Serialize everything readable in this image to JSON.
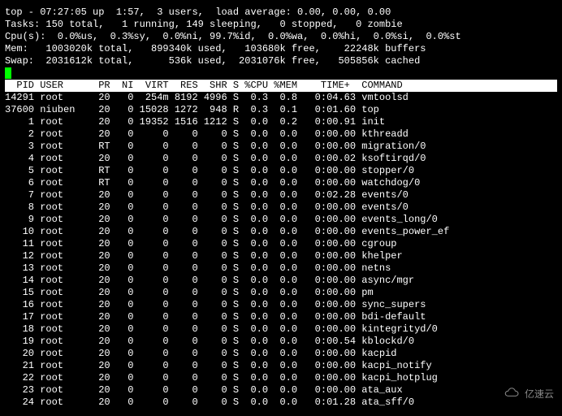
{
  "summary": {
    "line1": "top - 07:27:05 up  1:57,  3 users,  load average: 0.00, 0.00, 0.00",
    "line2": "Tasks: 150 total,   1 running, 149 sleeping,   0 stopped,   0 zombie",
    "line3": "Cpu(s):  0.0%us,  0.3%sy,  0.0%ni, 99.7%id,  0.0%wa,  0.0%hi,  0.0%si,  0.0%st",
    "line4": "Mem:   1003020k total,   899340k used,   103680k free,    22248k buffers",
    "line5": "Swap:  2031612k total,      536k used,  2031076k free,   505856k cached"
  },
  "columns": [
    "PID",
    "USER",
    "PR",
    "NI",
    "VIRT",
    "RES",
    "SHR",
    "S",
    "%CPU",
    "%MEM",
    "TIME+",
    "COMMAND"
  ],
  "header_text": "  PID USER      PR  NI  VIRT  RES  SHR S %CPU %MEM    TIME+  COMMAND           ",
  "processes": [
    {
      "pid": "14291",
      "user": "root",
      "pr": "20",
      "ni": "0",
      "virt": "254m",
      "res": "8192",
      "shr": "4996",
      "s": "S",
      "cpu": "0.3",
      "mem": "0.8",
      "time": "0:04.63",
      "cmd": "vmtoolsd"
    },
    {
      "pid": "37600",
      "user": "niuben",
      "pr": "20",
      "ni": "0",
      "virt": "15028",
      "res": "1272",
      "shr": "948",
      "s": "R",
      "cpu": "0.3",
      "mem": "0.1",
      "time": "0:01.60",
      "cmd": "top"
    },
    {
      "pid": "1",
      "user": "root",
      "pr": "20",
      "ni": "0",
      "virt": "19352",
      "res": "1516",
      "shr": "1212",
      "s": "S",
      "cpu": "0.0",
      "mem": "0.2",
      "time": "0:00.91",
      "cmd": "init"
    },
    {
      "pid": "2",
      "user": "root",
      "pr": "20",
      "ni": "0",
      "virt": "0",
      "res": "0",
      "shr": "0",
      "s": "S",
      "cpu": "0.0",
      "mem": "0.0",
      "time": "0:00.00",
      "cmd": "kthreadd"
    },
    {
      "pid": "3",
      "user": "root",
      "pr": "RT",
      "ni": "0",
      "virt": "0",
      "res": "0",
      "shr": "0",
      "s": "S",
      "cpu": "0.0",
      "mem": "0.0",
      "time": "0:00.00",
      "cmd": "migration/0"
    },
    {
      "pid": "4",
      "user": "root",
      "pr": "20",
      "ni": "0",
      "virt": "0",
      "res": "0",
      "shr": "0",
      "s": "S",
      "cpu": "0.0",
      "mem": "0.0",
      "time": "0:00.02",
      "cmd": "ksoftirqd/0"
    },
    {
      "pid": "5",
      "user": "root",
      "pr": "RT",
      "ni": "0",
      "virt": "0",
      "res": "0",
      "shr": "0",
      "s": "S",
      "cpu": "0.0",
      "mem": "0.0",
      "time": "0:00.00",
      "cmd": "stopper/0"
    },
    {
      "pid": "6",
      "user": "root",
      "pr": "RT",
      "ni": "0",
      "virt": "0",
      "res": "0",
      "shr": "0",
      "s": "S",
      "cpu": "0.0",
      "mem": "0.0",
      "time": "0:00.00",
      "cmd": "watchdog/0"
    },
    {
      "pid": "7",
      "user": "root",
      "pr": "20",
      "ni": "0",
      "virt": "0",
      "res": "0",
      "shr": "0",
      "s": "S",
      "cpu": "0.0",
      "mem": "0.0",
      "time": "0:02.28",
      "cmd": "events/0"
    },
    {
      "pid": "8",
      "user": "root",
      "pr": "20",
      "ni": "0",
      "virt": "0",
      "res": "0",
      "shr": "0",
      "s": "S",
      "cpu": "0.0",
      "mem": "0.0",
      "time": "0:00.00",
      "cmd": "events/0"
    },
    {
      "pid": "9",
      "user": "root",
      "pr": "20",
      "ni": "0",
      "virt": "0",
      "res": "0",
      "shr": "0",
      "s": "S",
      "cpu": "0.0",
      "mem": "0.0",
      "time": "0:00.00",
      "cmd": "events_long/0"
    },
    {
      "pid": "10",
      "user": "root",
      "pr": "20",
      "ni": "0",
      "virt": "0",
      "res": "0",
      "shr": "0",
      "s": "S",
      "cpu": "0.0",
      "mem": "0.0",
      "time": "0:00.00",
      "cmd": "events_power_ef"
    },
    {
      "pid": "11",
      "user": "root",
      "pr": "20",
      "ni": "0",
      "virt": "0",
      "res": "0",
      "shr": "0",
      "s": "S",
      "cpu": "0.0",
      "mem": "0.0",
      "time": "0:00.00",
      "cmd": "cgroup"
    },
    {
      "pid": "12",
      "user": "root",
      "pr": "20",
      "ni": "0",
      "virt": "0",
      "res": "0",
      "shr": "0",
      "s": "S",
      "cpu": "0.0",
      "mem": "0.0",
      "time": "0:00.00",
      "cmd": "khelper"
    },
    {
      "pid": "13",
      "user": "root",
      "pr": "20",
      "ni": "0",
      "virt": "0",
      "res": "0",
      "shr": "0",
      "s": "S",
      "cpu": "0.0",
      "mem": "0.0",
      "time": "0:00.00",
      "cmd": "netns"
    },
    {
      "pid": "14",
      "user": "root",
      "pr": "20",
      "ni": "0",
      "virt": "0",
      "res": "0",
      "shr": "0",
      "s": "S",
      "cpu": "0.0",
      "mem": "0.0",
      "time": "0:00.00",
      "cmd": "async/mgr"
    },
    {
      "pid": "15",
      "user": "root",
      "pr": "20",
      "ni": "0",
      "virt": "0",
      "res": "0",
      "shr": "0",
      "s": "S",
      "cpu": "0.0",
      "mem": "0.0",
      "time": "0:00.00",
      "cmd": "pm"
    },
    {
      "pid": "16",
      "user": "root",
      "pr": "20",
      "ni": "0",
      "virt": "0",
      "res": "0",
      "shr": "0",
      "s": "S",
      "cpu": "0.0",
      "mem": "0.0",
      "time": "0:00.00",
      "cmd": "sync_supers"
    },
    {
      "pid": "17",
      "user": "root",
      "pr": "20",
      "ni": "0",
      "virt": "0",
      "res": "0",
      "shr": "0",
      "s": "S",
      "cpu": "0.0",
      "mem": "0.0",
      "time": "0:00.00",
      "cmd": "bdi-default"
    },
    {
      "pid": "18",
      "user": "root",
      "pr": "20",
      "ni": "0",
      "virt": "0",
      "res": "0",
      "shr": "0",
      "s": "S",
      "cpu": "0.0",
      "mem": "0.0",
      "time": "0:00.00",
      "cmd": "kintegrityd/0"
    },
    {
      "pid": "19",
      "user": "root",
      "pr": "20",
      "ni": "0",
      "virt": "0",
      "res": "0",
      "shr": "0",
      "s": "S",
      "cpu": "0.0",
      "mem": "0.0",
      "time": "0:00.54",
      "cmd": "kblockd/0"
    },
    {
      "pid": "20",
      "user": "root",
      "pr": "20",
      "ni": "0",
      "virt": "0",
      "res": "0",
      "shr": "0",
      "s": "S",
      "cpu": "0.0",
      "mem": "0.0",
      "time": "0:00.00",
      "cmd": "kacpid"
    },
    {
      "pid": "21",
      "user": "root",
      "pr": "20",
      "ni": "0",
      "virt": "0",
      "res": "0",
      "shr": "0",
      "s": "S",
      "cpu": "0.0",
      "mem": "0.0",
      "time": "0:00.00",
      "cmd": "kacpi_notify"
    },
    {
      "pid": "22",
      "user": "root",
      "pr": "20",
      "ni": "0",
      "virt": "0",
      "res": "0",
      "shr": "0",
      "s": "S",
      "cpu": "0.0",
      "mem": "0.0",
      "time": "0:00.00",
      "cmd": "kacpi_hotplug"
    },
    {
      "pid": "23",
      "user": "root",
      "pr": "20",
      "ni": "0",
      "virt": "0",
      "res": "0",
      "shr": "0",
      "s": "S",
      "cpu": "0.0",
      "mem": "0.0",
      "time": "0:00.00",
      "cmd": "ata_aux"
    },
    {
      "pid": "24",
      "user": "root",
      "pr": "20",
      "ni": "0",
      "virt": "0",
      "res": "0",
      "shr": "0",
      "s": "S",
      "cpu": "0.0",
      "mem": "0.0",
      "time": "0:01.28",
      "cmd": "ata_sff/0"
    }
  ],
  "watermark": {
    "text": "亿速云"
  }
}
